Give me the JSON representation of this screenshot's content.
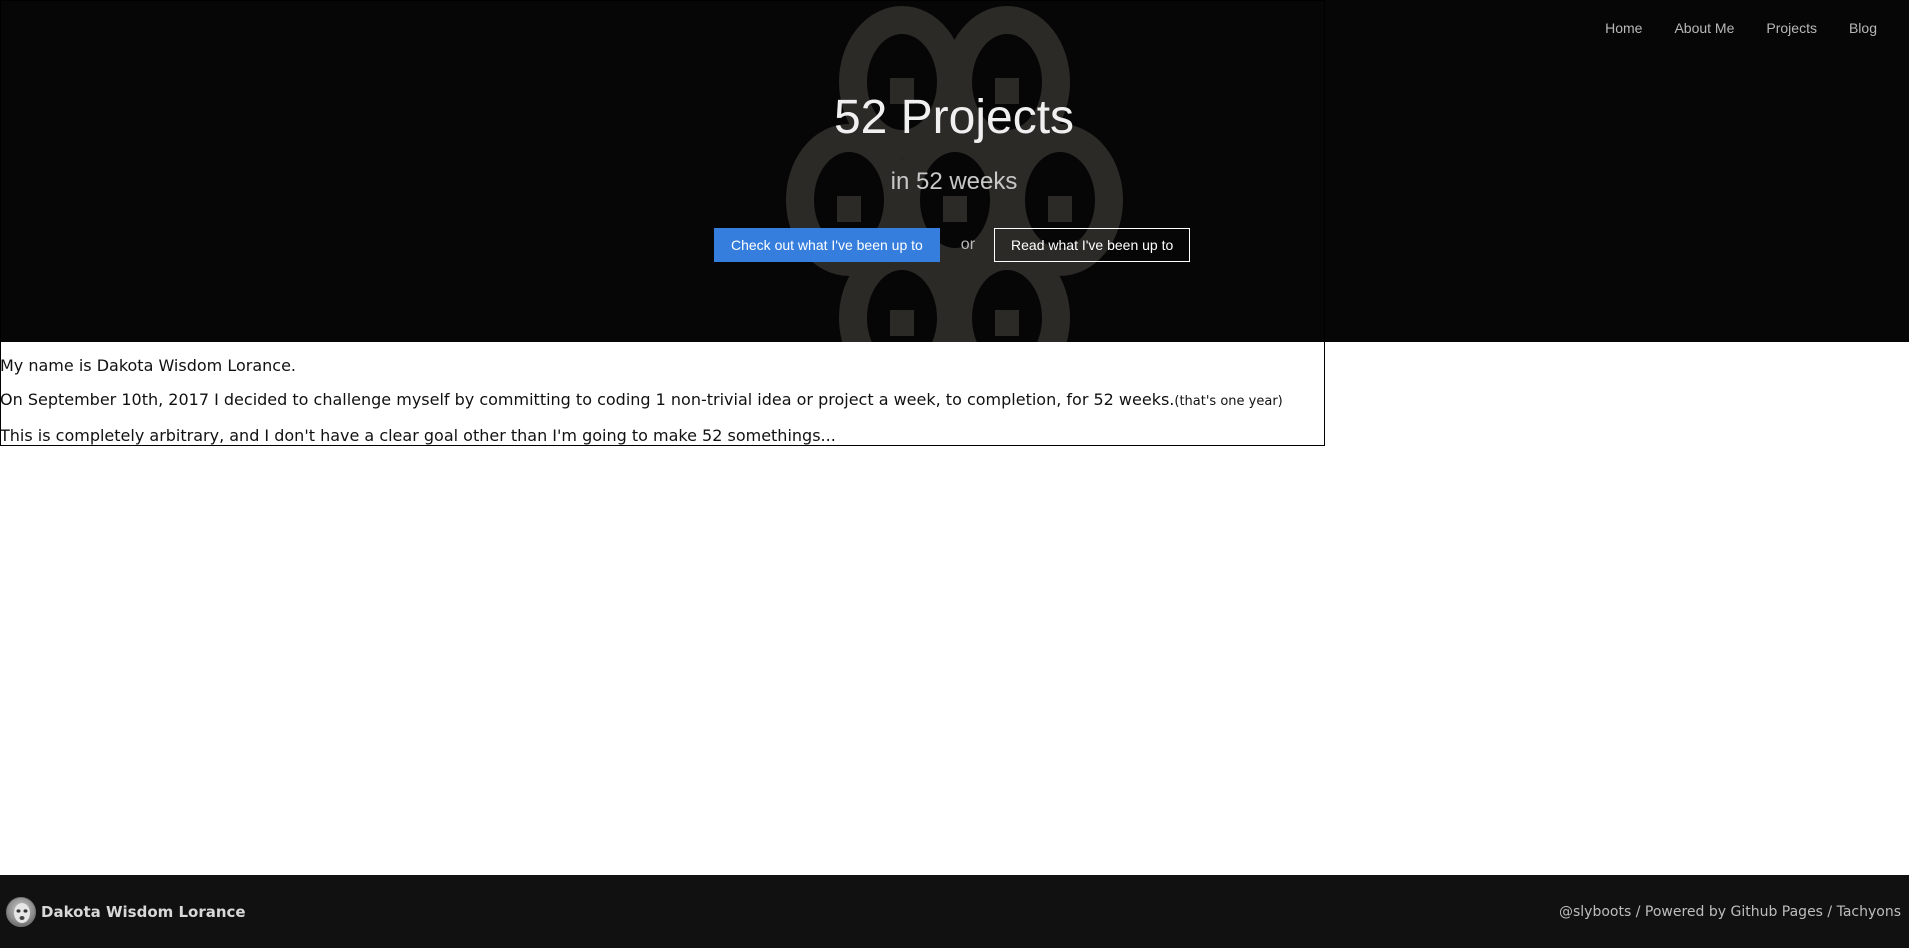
{
  "nav": {
    "items": [
      {
        "label": "Home"
      },
      {
        "label": "About Me"
      },
      {
        "label": "Projects"
      },
      {
        "label": "Blog"
      }
    ]
  },
  "hero": {
    "title": "52 Projects",
    "subtitle": "in 52 weeks",
    "primary_button": "Check out what I've been up to",
    "separator": "or",
    "secondary_button": "Read what I've been up to",
    "background_color": "#060606",
    "primary_color": "#357edd"
  },
  "intro": {
    "line1": "My name is Dakota Wisdom Lorance.",
    "line2": "On September 10th, 2017 I decided to challenge myself by committing to coding 1 non-trivial idea or project a week, to completion, for 52 weeks.",
    "line2_note": "(that's one year)",
    "line3": "This is completely arbitrary, and I don't have a clear goal other than I'm going to make 52 somethings..."
  },
  "footer": {
    "avatar_icon": "avatar",
    "name": "Dakota Wisdom Lorance",
    "credits": "@slyboots / Powered by Github Pages / Tachyons"
  }
}
